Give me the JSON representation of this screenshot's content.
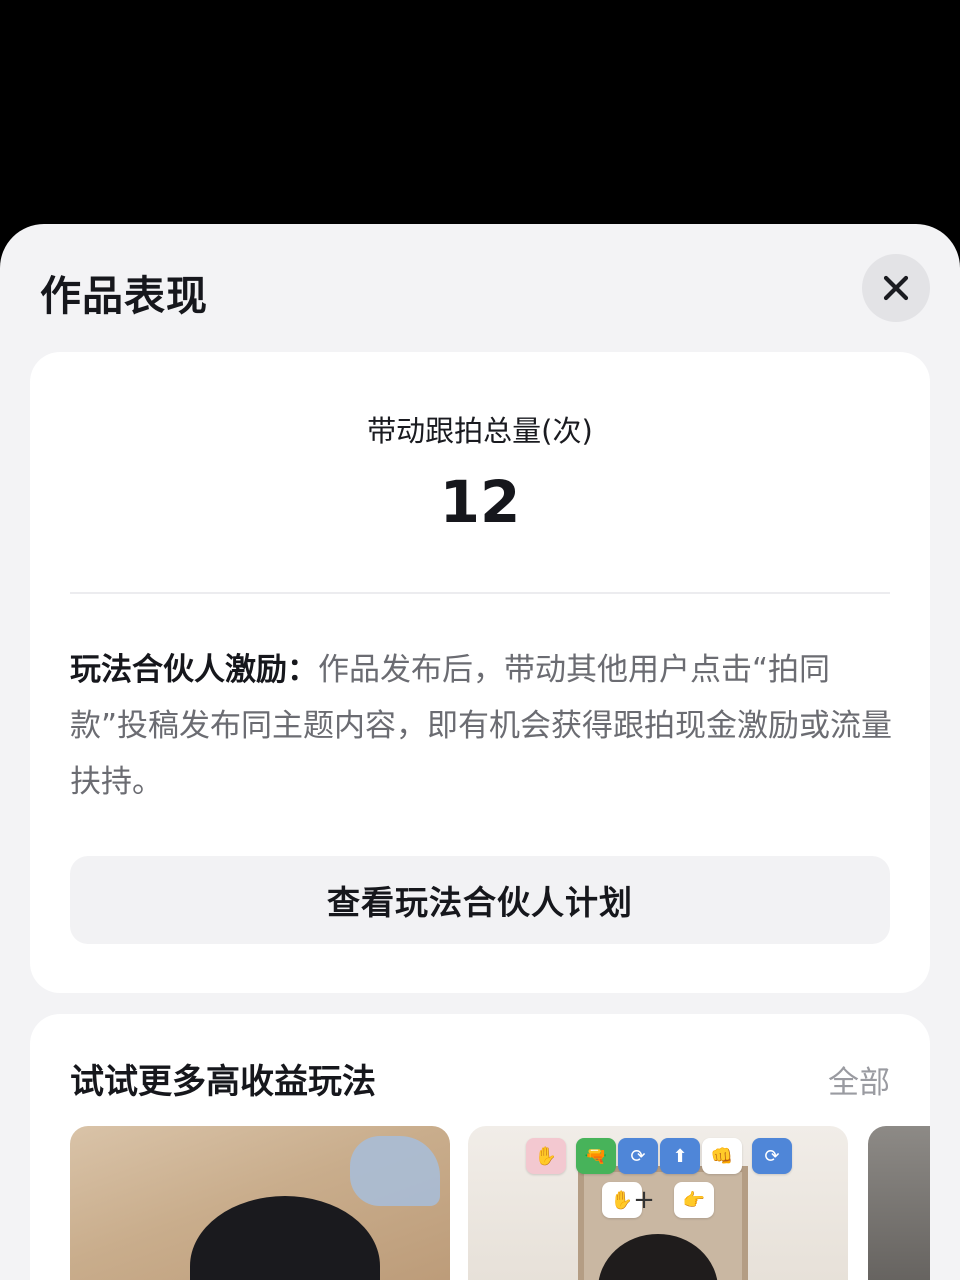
{
  "sheet": {
    "title": "作品表现"
  },
  "metric": {
    "label": "带动跟拍总量(次)",
    "value": "12"
  },
  "incentive": {
    "heading": "玩法合伙人激励：",
    "body": "作品发布后，带动其他用户点击“拍同款”投稿发布同主题内容，即有机会获得跟拍现金激励或流量扶持。"
  },
  "plan_button": {
    "label": "查看玩法合伙人计划"
  },
  "more": {
    "title": "试试更多高收益玩法",
    "all_label": "全部"
  },
  "thumb2_tiles": [
    "✋",
    "🔫",
    "⟳",
    "⬆",
    "👊",
    "⟳",
    "✋",
    "+",
    "👉"
  ],
  "icons": {
    "close": "close-icon"
  }
}
